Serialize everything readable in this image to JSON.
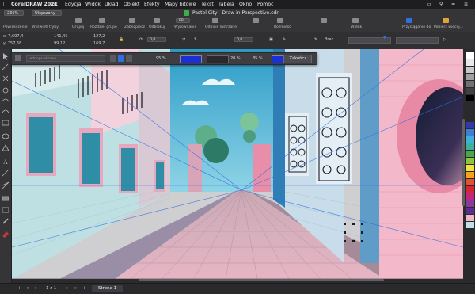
{
  "menubar": {
    "app": "CorelDRAW 2021",
    "items": [
      "Plik",
      "Edycja",
      "Widok",
      "Układ",
      "Obiekt",
      "Efekty",
      "Mapy bitowe",
      "Tekst",
      "Tabela",
      "Okno",
      "Pomoc"
    ]
  },
  "toolbar": {
    "zoom": "236%",
    "mode": "Ulepszony",
    "zoom_label": "Powiększenie",
    "mode_label": "Wyświetl tryby",
    "doc_title": "Pastel City - Draw in Perspective.cdr",
    "labels": [
      "Grupuj",
      "Rozdziel grupę",
      "Zabezpiecz",
      "Odblokuj",
      "Wyrównanie",
      "Odbicie lustrzane",
      "Rozmieść",
      "Widok",
      "Przyciąganie do",
      "Pobierz więcej..."
    ],
    "snap_value": "BP"
  },
  "propbar": {
    "x": "x: 7,697,4",
    "y": "y: 757,68",
    "w": "141,45",
    "h": "99,12",
    "sx": "127,2",
    "sy": "169,7",
    "angle": "0,0",
    "angle2": "0,0",
    "outline": "Brak"
  },
  "perspbar": {
    "type": "Jednopunktowy",
    "opacity": "95 %",
    "opacity2": "20 %",
    "opacity3": "85 %",
    "end_label": "Zakończ"
  },
  "statusbar": {
    "page_of": "1 z 1",
    "page_tab": "Strona 1"
  },
  "colors": {
    "sky": "#3aa6cc",
    "pink": "#f2b8c8",
    "blue_wall": "#bfe0e8",
    "accent": "#2f6fe0"
  }
}
